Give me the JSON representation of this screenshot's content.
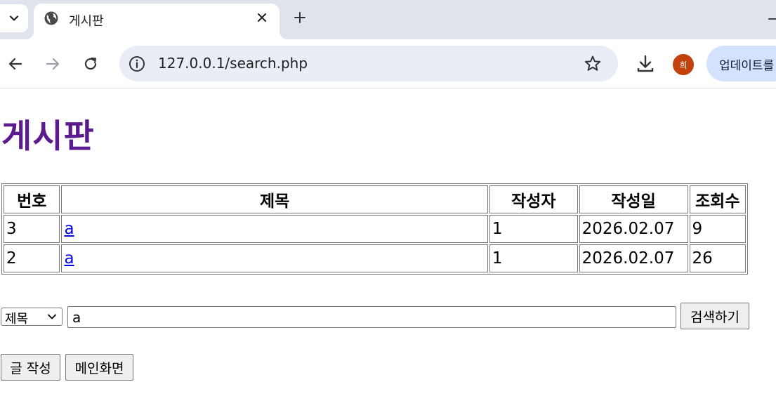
{
  "browser": {
    "tab_title": "게시판",
    "url": "127.0.0.1/search.php",
    "profile_initial": "희",
    "update_label": "업데이트를"
  },
  "page": {
    "title": "게시판",
    "table": {
      "headers": [
        "번호",
        "제목",
        "작성자",
        "작성일",
        "조회수"
      ],
      "rows": [
        {
          "num": "3",
          "title": "a",
          "author": "1",
          "date": "2026.02.07",
          "views": "9"
        },
        {
          "num": "2",
          "title": "a",
          "author": "1",
          "date": "2026.02.07",
          "views": "26"
        }
      ]
    },
    "search": {
      "field_selected": "제목",
      "query": "a",
      "button_label": "검색하기"
    },
    "actions": {
      "write_label": "글 작성",
      "main_label": "메인화면"
    }
  },
  "colors": {
    "title": "#5b1b8e",
    "link": "#0000ee",
    "avatar": "#c2410c",
    "update_pill": "#d3e3fd"
  }
}
